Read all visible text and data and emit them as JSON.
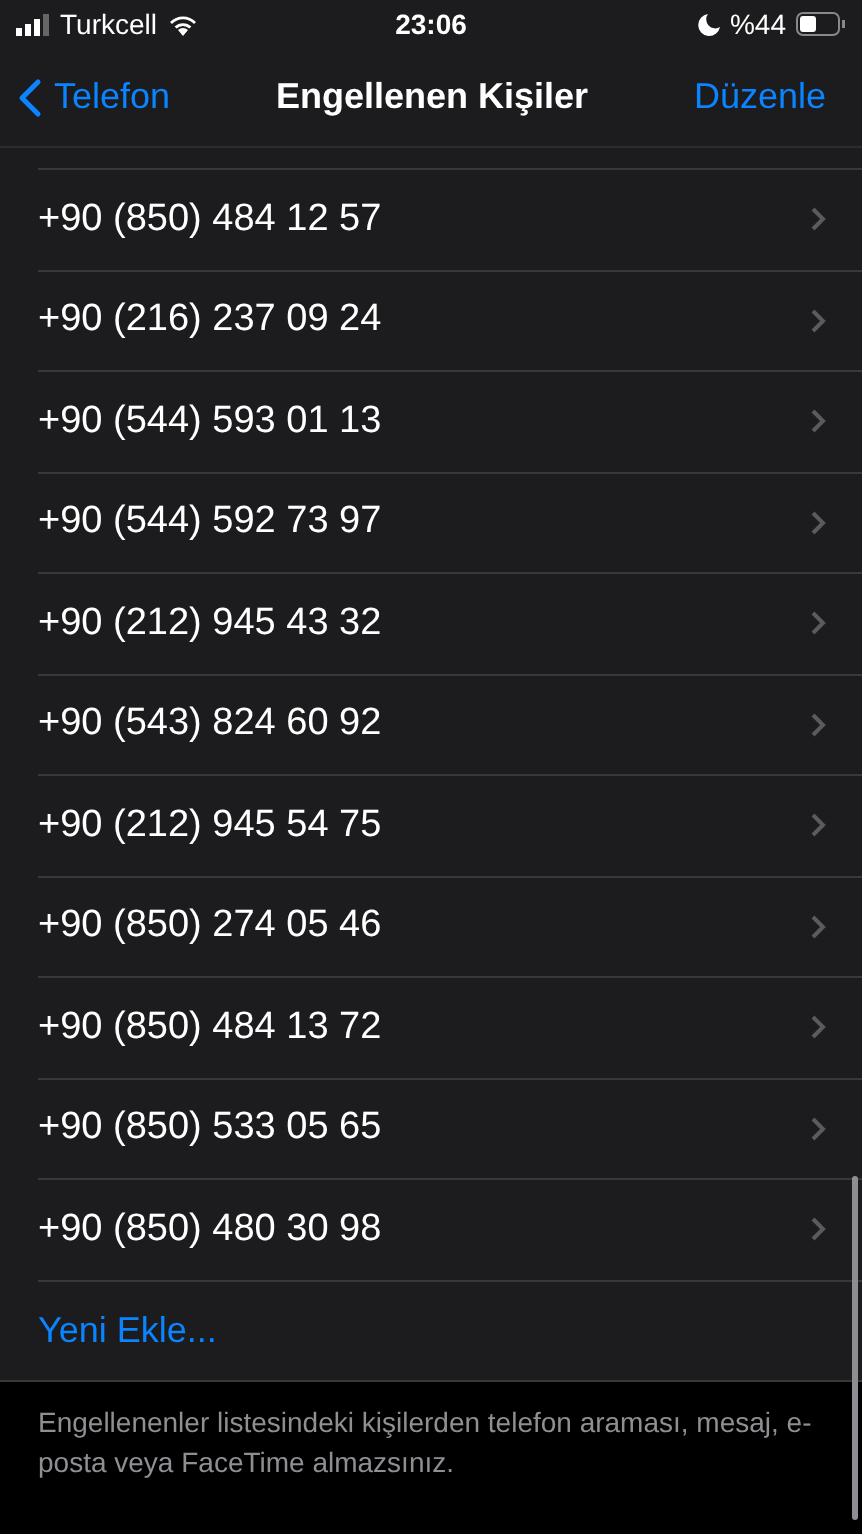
{
  "status_bar": {
    "carrier": "Turkcell",
    "time": "23:06",
    "battery": "%44"
  },
  "nav": {
    "back": "Telefon",
    "title": "Engellenen Kişiler",
    "action": "Düzenle"
  },
  "blocked_numbers": [
    "+90 (850) 484 12 57",
    "+90 (216) 237 09 24",
    "+90 (544) 593 01 13",
    "+90 (544) 592 73 97",
    "+90 (212) 945 43 32",
    "+90 (543) 824 60 92",
    "+90 (212) 945 54 75",
    "+90 (850) 274 05 46",
    "+90 (850) 484 13 72",
    "+90 (850) 533 05 65",
    "+90 (850) 480 30 98"
  ],
  "add_new": "Yeni Ekle...",
  "footer": "Engellenenler listesindeki kişilerden telefon araması, mesaj, e-posta veya FaceTime almazsınız."
}
